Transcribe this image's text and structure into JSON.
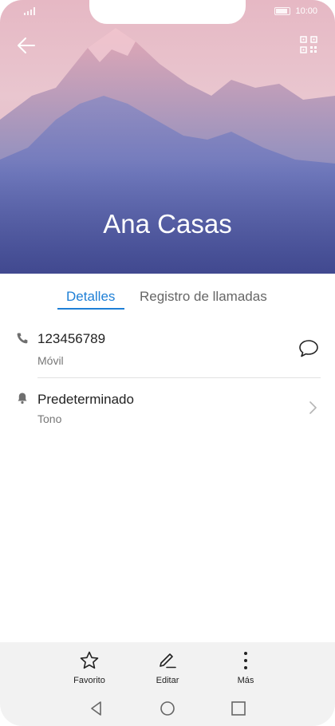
{
  "status": {
    "time": "10:00"
  },
  "contact": {
    "name": "Ana Casas"
  },
  "tabs": [
    {
      "label": "Detalles",
      "active": true
    },
    {
      "label": "Registro de llamadas",
      "active": false
    }
  ],
  "details": {
    "phone": {
      "number": "123456789",
      "type": "Móvil",
      "icon": "phone-icon"
    },
    "ringtone": {
      "value": "Predeterminado",
      "label": "Tono",
      "icon": "bell-icon"
    }
  },
  "actions": [
    {
      "label": "Favorito",
      "icon": "star-icon"
    },
    {
      "label": "Editar",
      "icon": "pencil-icon"
    },
    {
      "label": "Más",
      "icon": "more-vertical-icon"
    }
  ],
  "colors": {
    "accent": "#1e7fd6",
    "hero_top": "#e8c3cc",
    "hero_bottom": "#4a55a2"
  }
}
